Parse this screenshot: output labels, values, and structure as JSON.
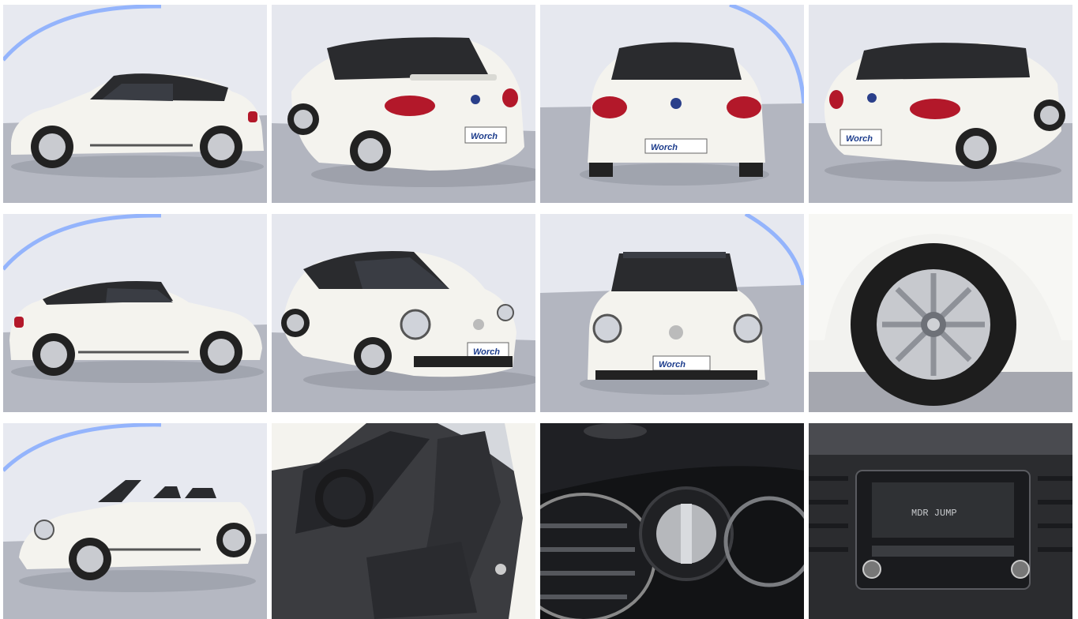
{
  "gallery": {
    "photos": [
      {
        "label": "side-left-closed-top"
      },
      {
        "label": "rear-three-quarter-left"
      },
      {
        "label": "rear"
      },
      {
        "label": "rear-three-quarter-right"
      },
      {
        "label": "side-right-closed-top"
      },
      {
        "label": "front-three-quarter-left"
      },
      {
        "label": "front"
      },
      {
        "label": "wheel-detail"
      },
      {
        "label": "side-left-open-top"
      },
      {
        "label": "interior-front-seats"
      },
      {
        "label": "light-switch-detail"
      },
      {
        "label": "radio-detail"
      }
    ],
    "plate_text": "Worch",
    "radio_display": "MDR JUMP"
  },
  "colors": {
    "car_body": "#f4f3ee",
    "soft_top": "#2a2b2e",
    "studio_wall": "#e6e8ef",
    "studio_floor": "#a9acb6",
    "accent_light": "#7fa6ff",
    "tail_light": "#b3182a"
  }
}
